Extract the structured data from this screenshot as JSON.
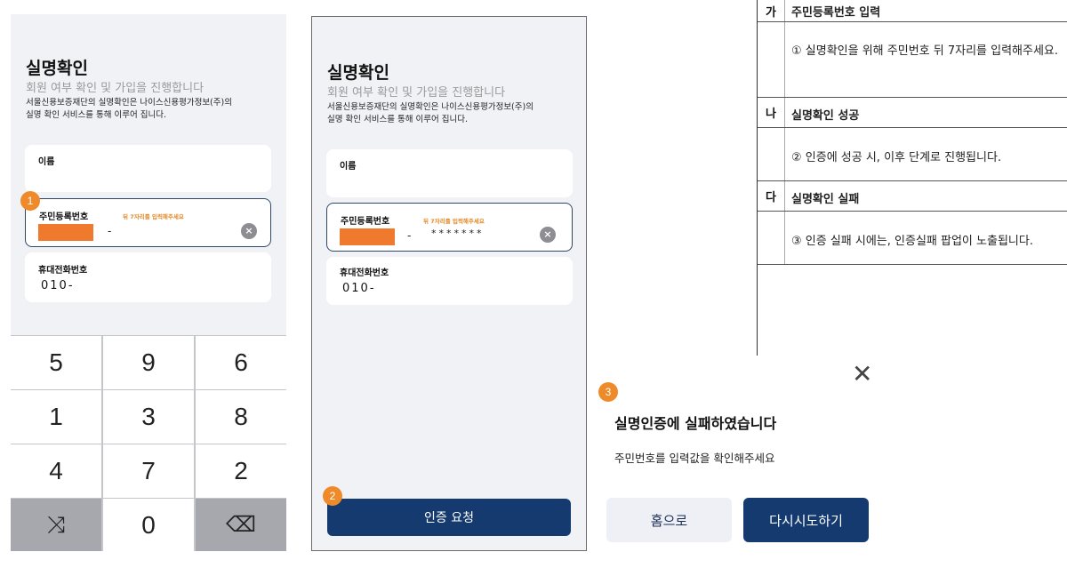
{
  "screen_common": {
    "title": "실명확인",
    "subtitle": "회원 여부 확인 및 가입을 진행합니다",
    "desc_line1": "서울신용보증재단의 실명확인은 나이스신용평가정보(주)의",
    "desc_line2": "실명 확인 서비스를 통해 이루어 집니다.",
    "name_label": "이름",
    "rrn_label": "주민등록번호",
    "rrn_hint": "뒤 7자리를 입력해주세요",
    "rrn_dash": "-",
    "phone_label": "휴대전화번호",
    "phone_value": "010-",
    "clear_icon": "×"
  },
  "screen1": {
    "badge": "1",
    "keypad": [
      "5",
      "9",
      "6",
      "1",
      "3",
      "8",
      "4",
      "7",
      "2",
      "",
      "0",
      ""
    ],
    "shuffle_icon": "⤨",
    "backspace_icon": "⌫"
  },
  "screen2": {
    "badge": "2",
    "rrn_masked_back": "*******",
    "submit_label": "인증 요청"
  },
  "table": {
    "rows": [
      {
        "num": "가",
        "text": "주민등록번호 입력"
      },
      {
        "num": "",
        "text": "① 실명확인을 위해 주민번호 뒤 7자리를 입력해주세요."
      },
      {
        "num": "나",
        "text": "실명확인 성공"
      },
      {
        "num": "",
        "text": "② 인증에 성공 시, 이후 단계로 진행됩니다."
      },
      {
        "num": "다",
        "text": "실명확인 실패"
      },
      {
        "num": "",
        "text": "③ 인증 실패 시에는, 인증실패 팝업이 노출됩니다."
      }
    ]
  },
  "popup": {
    "badge": "3",
    "close_icon": "✕",
    "title": "실명인증에 실패하였습니다",
    "message": "주민번호를 입력값을 확인해주세요",
    "home_label": "홈으로",
    "retry_label": "다시시도하기"
  },
  "colors": {
    "primary": "#143a70",
    "accent_orange": "#ef7a2e",
    "screen_bg": "#f1f2f6"
  }
}
